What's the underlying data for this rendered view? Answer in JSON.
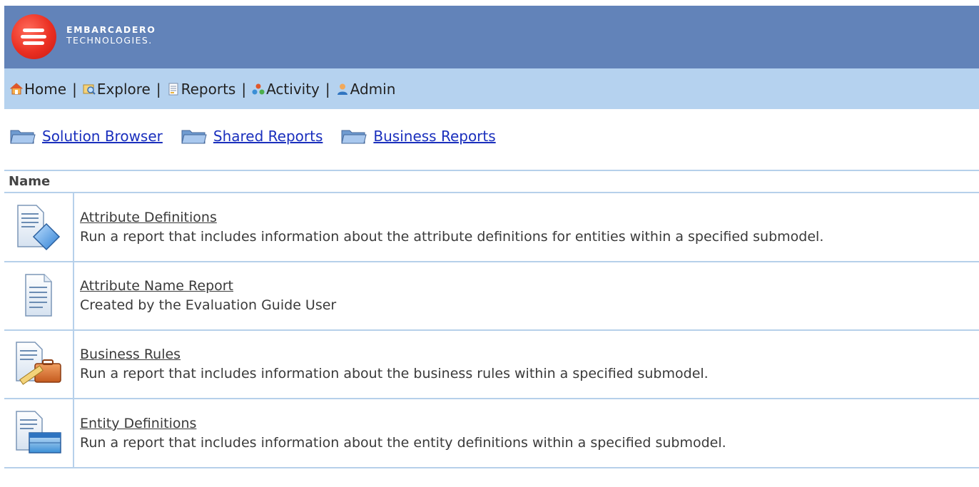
{
  "header": {
    "brand_line1": "EMBARCADERO",
    "brand_line2": "TECHNOLOGIES.",
    "header_color": "#6283b9",
    "logo_color": "#ea2f22"
  },
  "nav": {
    "items": [
      {
        "label": "Home",
        "icon": "home-icon"
      },
      {
        "label": "Explore",
        "icon": "explore-icon"
      },
      {
        "label": "Reports",
        "icon": "reports-icon"
      },
      {
        "label": "Activity",
        "icon": "activity-icon"
      },
      {
        "label": "Admin",
        "icon": "admin-icon"
      }
    ],
    "separator": "|",
    "bar_color": "#b5d2ef"
  },
  "folders": [
    {
      "label": "Solution Browser",
      "icon": "folder-icon"
    },
    {
      "label": "Shared Reports",
      "icon": "folder-icon"
    },
    {
      "label": "Business Reports",
      "icon": "folder-icon"
    }
  ],
  "table": {
    "column_header": "Name",
    "rows": [
      {
        "title": "Attribute Definitions",
        "description": "Run a report that includes information about the attribute definitions for entities within a specified submodel.",
        "icon": "report-diamond-icon"
      },
      {
        "title": "Attribute Name Report",
        "description": "Created by the Evaluation Guide User",
        "icon": "report-document-icon"
      },
      {
        "title": "Business Rules",
        "description": "Run a report that includes information about the business rules within a specified submodel.",
        "icon": "report-briefcase-icon"
      },
      {
        "title": "Entity Definitions",
        "description": "Run a report that includes information about the entity definitions within a specified submodel.",
        "icon": "report-table-icon"
      }
    ]
  },
  "link_color": "#1a2fbd",
  "grid_line_color": "#b6d0ea"
}
